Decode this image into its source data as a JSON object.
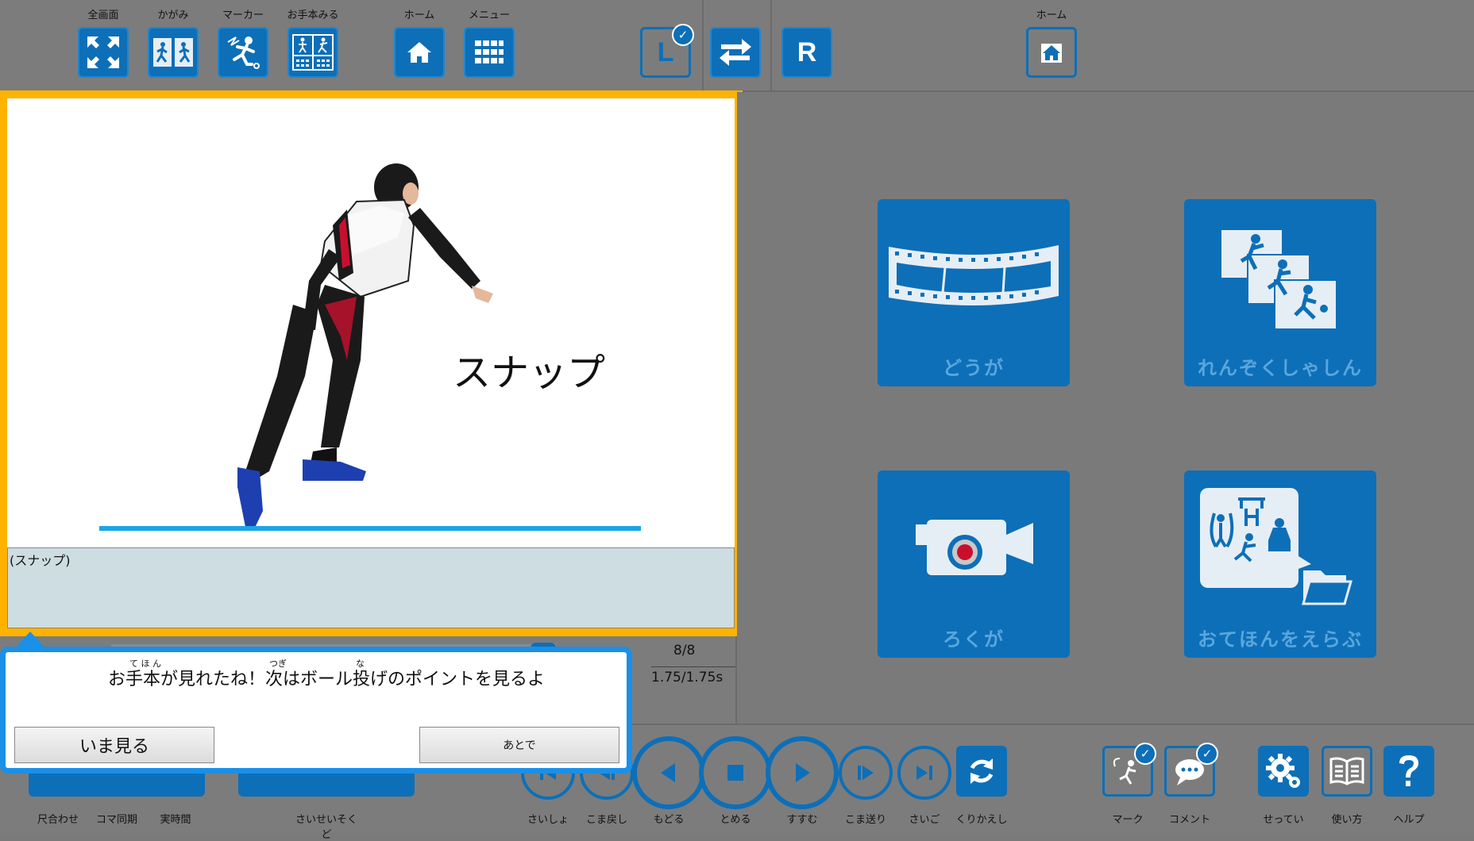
{
  "top_toolbar": {
    "fullscreen": "全画面",
    "mirror": "かがみ",
    "marker": "マーカー",
    "view_model": "お手本みる",
    "home": "ホーム",
    "menu": "メニュー",
    "right_home": "ホーム",
    "left_letter": "L",
    "right_letter": "R"
  },
  "video": {
    "overlay_text": "スナップ",
    "caption": "(スナップ)",
    "frame_count": "8/8",
    "time": "1.75/1.75s",
    "progress": 1.0
  },
  "tiles": [
    {
      "label": "どうが",
      "icon": "film-strip-icon"
    },
    {
      "label": "れんぞくしゃしん",
      "icon": "photo-sequence-icon"
    },
    {
      "label": "ろくが",
      "icon": "video-camera-icon"
    },
    {
      "label": "おてほんをえらぶ",
      "icon": "choose-model-folder-icon"
    }
  ],
  "bottom_toolbar": {
    "sync_size": "尺合わせ",
    "frame_sync": "コマ同期",
    "real_time": "実時間",
    "speed": "さいせいそくど",
    "first": "さいしょ",
    "step_back": "こま戻し",
    "back": "もどる",
    "stop": "とめる",
    "play": "すすむ",
    "step_forward": "こま送り",
    "last": "さいご",
    "repeat": "くりかえし",
    "mark": "マーク",
    "comment": "コメント",
    "settings": "せってい",
    "usage": "使い方",
    "help": "ヘルプ"
  },
  "dialog": {
    "message": "お手本が見れたね！次はボール投げのポイントを見るよ",
    "ruby_tehon": "て ほ ん",
    "ruby_tsugi": "つぎ",
    "ruby_na": "な",
    "now_button": "いま見る",
    "later_button": "あとで"
  },
  "colors": {
    "accent": "#0d6fb8",
    "frame": "#ffb300",
    "dialog_border": "#1a90e8",
    "ground_line": "#19a6e6"
  }
}
